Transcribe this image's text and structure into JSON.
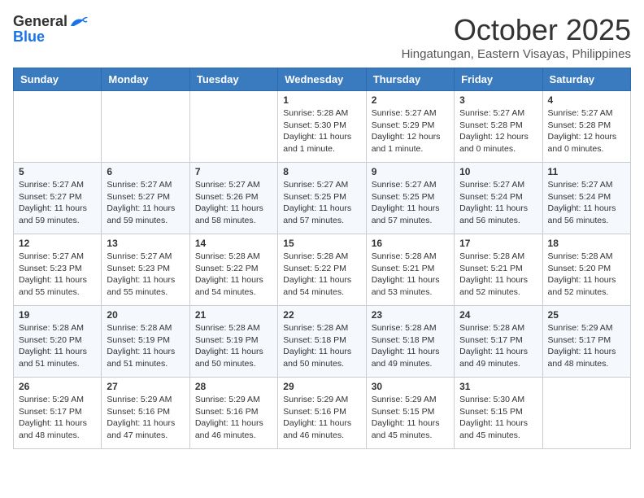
{
  "logo": {
    "general": "General",
    "blue": "Blue"
  },
  "title": "October 2025",
  "location": "Hingatungan, Eastern Visayas, Philippines",
  "headers": [
    "Sunday",
    "Monday",
    "Tuesday",
    "Wednesday",
    "Thursday",
    "Friday",
    "Saturday"
  ],
  "weeks": [
    [
      {
        "day": "",
        "sunrise": "",
        "sunset": "",
        "daylight": ""
      },
      {
        "day": "",
        "sunrise": "",
        "sunset": "",
        "daylight": ""
      },
      {
        "day": "",
        "sunrise": "",
        "sunset": "",
        "daylight": ""
      },
      {
        "day": "1",
        "sunrise": "Sunrise: 5:28 AM",
        "sunset": "Sunset: 5:30 PM",
        "daylight": "Daylight: 11 hours and 1 minute."
      },
      {
        "day": "2",
        "sunrise": "Sunrise: 5:27 AM",
        "sunset": "Sunset: 5:29 PM",
        "daylight": "Daylight: 12 hours and 1 minute."
      },
      {
        "day": "3",
        "sunrise": "Sunrise: 5:27 AM",
        "sunset": "Sunset: 5:28 PM",
        "daylight": "Daylight: 12 hours and 0 minutes."
      },
      {
        "day": "4",
        "sunrise": "Sunrise: 5:27 AM",
        "sunset": "Sunset: 5:28 PM",
        "daylight": "Daylight: 12 hours and 0 minutes."
      }
    ],
    [
      {
        "day": "5",
        "sunrise": "Sunrise: 5:27 AM",
        "sunset": "Sunset: 5:27 PM",
        "daylight": "Daylight: 11 hours and 59 minutes."
      },
      {
        "day": "6",
        "sunrise": "Sunrise: 5:27 AM",
        "sunset": "Sunset: 5:27 PM",
        "daylight": "Daylight: 11 hours and 59 minutes."
      },
      {
        "day": "7",
        "sunrise": "Sunrise: 5:27 AM",
        "sunset": "Sunset: 5:26 PM",
        "daylight": "Daylight: 11 hours and 58 minutes."
      },
      {
        "day": "8",
        "sunrise": "Sunrise: 5:27 AM",
        "sunset": "Sunset: 5:25 PM",
        "daylight": "Daylight: 11 hours and 57 minutes."
      },
      {
        "day": "9",
        "sunrise": "Sunrise: 5:27 AM",
        "sunset": "Sunset: 5:25 PM",
        "daylight": "Daylight: 11 hours and 57 minutes."
      },
      {
        "day": "10",
        "sunrise": "Sunrise: 5:27 AM",
        "sunset": "Sunset: 5:24 PM",
        "daylight": "Daylight: 11 hours and 56 minutes."
      },
      {
        "day": "11",
        "sunrise": "Sunrise: 5:27 AM",
        "sunset": "Sunset: 5:24 PM",
        "daylight": "Daylight: 11 hours and 56 minutes."
      }
    ],
    [
      {
        "day": "12",
        "sunrise": "Sunrise: 5:27 AM",
        "sunset": "Sunset: 5:23 PM",
        "daylight": "Daylight: 11 hours and 55 minutes."
      },
      {
        "day": "13",
        "sunrise": "Sunrise: 5:27 AM",
        "sunset": "Sunset: 5:23 PM",
        "daylight": "Daylight: 11 hours and 55 minutes."
      },
      {
        "day": "14",
        "sunrise": "Sunrise: 5:28 AM",
        "sunset": "Sunset: 5:22 PM",
        "daylight": "Daylight: 11 hours and 54 minutes."
      },
      {
        "day": "15",
        "sunrise": "Sunrise: 5:28 AM",
        "sunset": "Sunset: 5:22 PM",
        "daylight": "Daylight: 11 hours and 54 minutes."
      },
      {
        "day": "16",
        "sunrise": "Sunrise: 5:28 AM",
        "sunset": "Sunset: 5:21 PM",
        "daylight": "Daylight: 11 hours and 53 minutes."
      },
      {
        "day": "17",
        "sunrise": "Sunrise: 5:28 AM",
        "sunset": "Sunset: 5:21 PM",
        "daylight": "Daylight: 11 hours and 52 minutes."
      },
      {
        "day": "18",
        "sunrise": "Sunrise: 5:28 AM",
        "sunset": "Sunset: 5:20 PM",
        "daylight": "Daylight: 11 hours and 52 minutes."
      }
    ],
    [
      {
        "day": "19",
        "sunrise": "Sunrise: 5:28 AM",
        "sunset": "Sunset: 5:20 PM",
        "daylight": "Daylight: 11 hours and 51 minutes."
      },
      {
        "day": "20",
        "sunrise": "Sunrise: 5:28 AM",
        "sunset": "Sunset: 5:19 PM",
        "daylight": "Daylight: 11 hours and 51 minutes."
      },
      {
        "day": "21",
        "sunrise": "Sunrise: 5:28 AM",
        "sunset": "Sunset: 5:19 PM",
        "daylight": "Daylight: 11 hours and 50 minutes."
      },
      {
        "day": "22",
        "sunrise": "Sunrise: 5:28 AM",
        "sunset": "Sunset: 5:18 PM",
        "daylight": "Daylight: 11 hours and 50 minutes."
      },
      {
        "day": "23",
        "sunrise": "Sunrise: 5:28 AM",
        "sunset": "Sunset: 5:18 PM",
        "daylight": "Daylight: 11 hours and 49 minutes."
      },
      {
        "day": "24",
        "sunrise": "Sunrise: 5:28 AM",
        "sunset": "Sunset: 5:17 PM",
        "daylight": "Daylight: 11 hours and 49 minutes."
      },
      {
        "day": "25",
        "sunrise": "Sunrise: 5:29 AM",
        "sunset": "Sunset: 5:17 PM",
        "daylight": "Daylight: 11 hours and 48 minutes."
      }
    ],
    [
      {
        "day": "26",
        "sunrise": "Sunrise: 5:29 AM",
        "sunset": "Sunset: 5:17 PM",
        "daylight": "Daylight: 11 hours and 48 minutes."
      },
      {
        "day": "27",
        "sunrise": "Sunrise: 5:29 AM",
        "sunset": "Sunset: 5:16 PM",
        "daylight": "Daylight: 11 hours and 47 minutes."
      },
      {
        "day": "28",
        "sunrise": "Sunrise: 5:29 AM",
        "sunset": "Sunset: 5:16 PM",
        "daylight": "Daylight: 11 hours and 46 minutes."
      },
      {
        "day": "29",
        "sunrise": "Sunrise: 5:29 AM",
        "sunset": "Sunset: 5:16 PM",
        "daylight": "Daylight: 11 hours and 46 minutes."
      },
      {
        "day": "30",
        "sunrise": "Sunrise: 5:29 AM",
        "sunset": "Sunset: 5:15 PM",
        "daylight": "Daylight: 11 hours and 45 minutes."
      },
      {
        "day": "31",
        "sunrise": "Sunrise: 5:30 AM",
        "sunset": "Sunset: 5:15 PM",
        "daylight": "Daylight: 11 hours and 45 minutes."
      },
      {
        "day": "",
        "sunrise": "",
        "sunset": "",
        "daylight": ""
      }
    ]
  ]
}
